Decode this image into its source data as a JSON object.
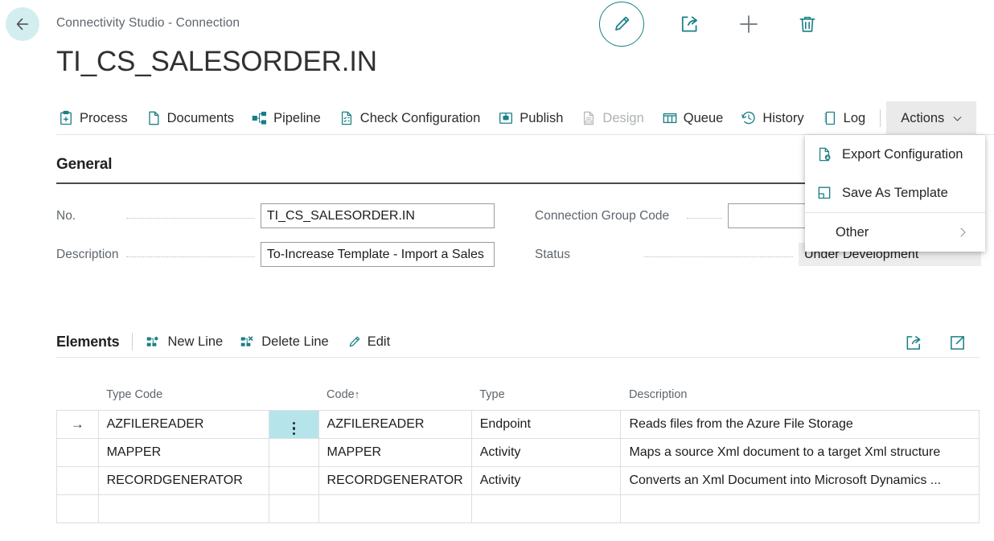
{
  "topbar": {
    "back_icon": "arrow-left-icon",
    "breadcrumb": "Connectivity Studio - Connection",
    "actions": [
      {
        "name": "edit-button",
        "icon": "pencil-icon",
        "label": "Edit"
      },
      {
        "name": "share-button",
        "icon": "share-icon",
        "label": "Share"
      },
      {
        "name": "new-button",
        "icon": "plus-icon",
        "label": "New"
      },
      {
        "name": "delete-button",
        "icon": "trash-icon",
        "label": "Delete"
      }
    ]
  },
  "page_title": "TI_CS_SALESORDER.IN",
  "ribbon": {
    "items": [
      {
        "label": "Process",
        "icon": "process-clipboard-icon",
        "disabled": false
      },
      {
        "label": "Documents",
        "icon": "document-icon",
        "disabled": false
      },
      {
        "label": "Pipeline",
        "icon": "pipeline-nodes-icon",
        "disabled": false
      },
      {
        "label": "Check Configuration",
        "icon": "check-config-icon",
        "disabled": false
      },
      {
        "label": "Publish",
        "icon": "publish-chip-icon",
        "disabled": false
      },
      {
        "label": "Design",
        "icon": "design-icon",
        "disabled": true
      },
      {
        "label": "Queue",
        "icon": "queue-columns-icon",
        "disabled": false
      },
      {
        "label": "History",
        "icon": "history-clock-icon",
        "disabled": false
      },
      {
        "label": "Log",
        "icon": "log-notebook-icon",
        "disabled": false
      }
    ],
    "actions_label": "Actions",
    "actions_chevron": "chevron-down-icon"
  },
  "actions_menu": {
    "items": [
      {
        "label": "Export Configuration",
        "icon": "export-file-icon",
        "submenu": false
      },
      {
        "label": "Save As Template",
        "icon": "save-template-icon",
        "submenu": false
      },
      {
        "label": "Other",
        "icon": "",
        "submenu": true,
        "chevron": "chevron-right-icon"
      }
    ]
  },
  "general": {
    "heading": "General",
    "fields": {
      "no_label": "No.",
      "no_value": "TI_CS_SALESORDER.IN",
      "description_label": "Description",
      "description_value": "To-Increase Template - Import a Sales ",
      "group_code_label": "Connection Group Code",
      "group_code_value": "",
      "status_label": "Status",
      "status_value": "Under Development"
    }
  },
  "elements": {
    "title": "Elements",
    "actions": [
      {
        "label": "New Line",
        "icon": "new-line-icon"
      },
      {
        "label": "Delete Line",
        "icon": "delete-line-icon"
      },
      {
        "label": "Edit",
        "icon": "pencil-icon"
      }
    ],
    "right_icons": [
      {
        "name": "share-icon",
        "label": "Share"
      },
      {
        "name": "open-in-new-icon",
        "label": "Open in full"
      }
    ],
    "columns": [
      {
        "key": "type_code",
        "label": "Type Code",
        "sorted": false
      },
      {
        "key": "code",
        "label": "Code",
        "sorted": true,
        "sort_dir": "↑"
      },
      {
        "key": "type",
        "label": "Type",
        "sorted": false
      },
      {
        "key": "description",
        "label": "Description",
        "sorted": false
      }
    ],
    "rows": [
      {
        "selected": true,
        "row_indicator": "→",
        "type_code": "AZFILEREADER",
        "code": "AZFILEREADER",
        "type": "Endpoint",
        "description": "Reads files from the Azure File Storage"
      },
      {
        "selected": false,
        "row_indicator": "",
        "type_code": "MAPPER",
        "code": "MAPPER",
        "type": "Activity",
        "description": "Maps a source Xml document to a target Xml structure"
      },
      {
        "selected": false,
        "row_indicator": "",
        "type_code": "RECORDGENERATOR",
        "code": "RECORDGENERATOR",
        "type": "Activity",
        "description": "Converts an Xml Document into Microsoft Dynamics ..."
      },
      {
        "selected": false,
        "row_indicator": "",
        "type_code": "",
        "code": "",
        "type": "",
        "description": ""
      }
    ]
  },
  "colors": {
    "accent_teal": "#1a7f86",
    "back_circle": "#d4eef0",
    "row_highlight": "#b5e5ea",
    "actions_bg": "#eaeaea",
    "readonly_bg": "#ededed",
    "label_gray": "#5e666d",
    "border_gray": "#dedede"
  }
}
